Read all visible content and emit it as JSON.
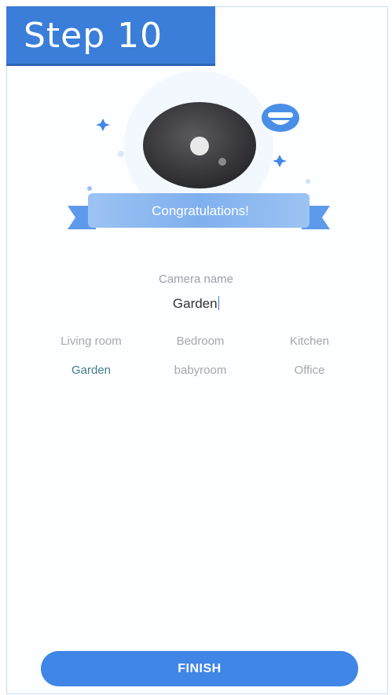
{
  "step_badge": "Step 10",
  "banner_text": "Congratulations!",
  "camera_name": {
    "label": "Camera name",
    "value": "Garden"
  },
  "room_options": [
    "Living room",
    "Bedroom",
    "Kitchen",
    "Garden",
    "babyroom",
    "Office"
  ],
  "selected_room": "Garden",
  "finish_button": "FINISH",
  "colors": {
    "accent": "#3f86e6",
    "badge": "#3a7ed9",
    "selected_text": "#3f7d8c",
    "muted_text": "#a3a8ae"
  },
  "icons": [
    "camera-lens-icon",
    "chat-bubble-icon",
    "sparkle-icon",
    "ribbon-banner-icon"
  ]
}
